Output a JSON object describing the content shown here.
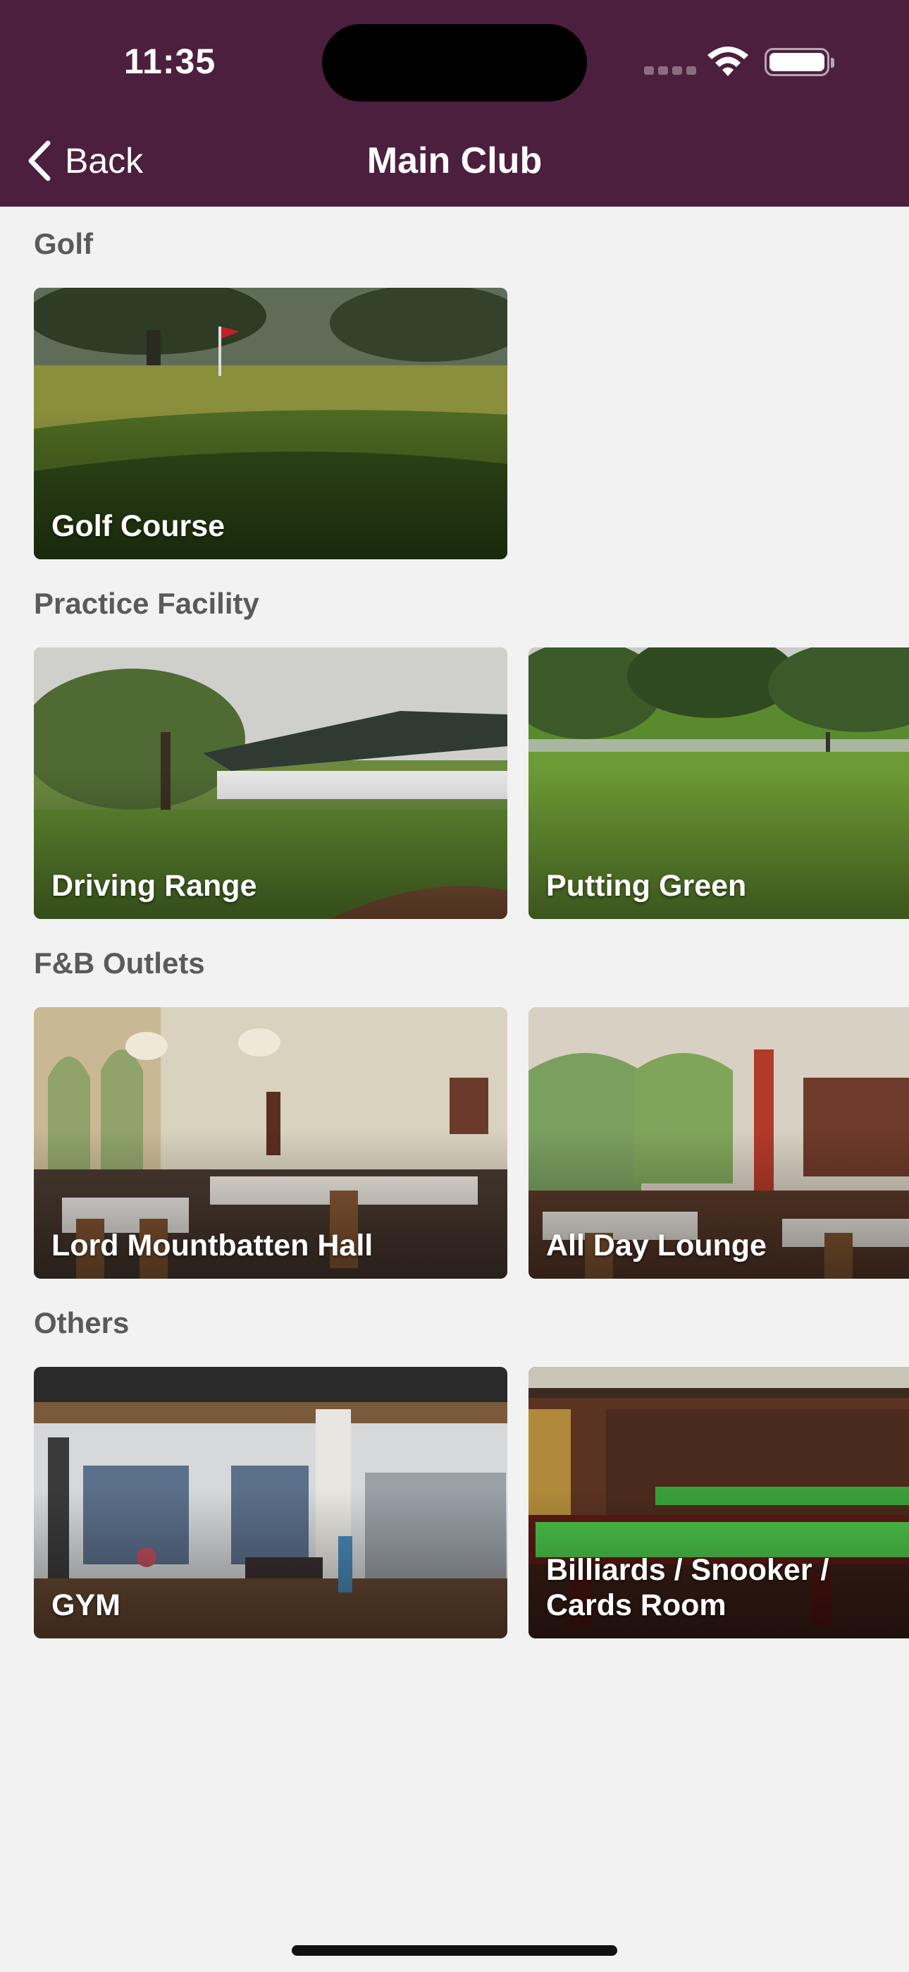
{
  "status_bar": {
    "time": "11:35"
  },
  "nav": {
    "back_label": "Back",
    "title": "Main Club"
  },
  "sections": [
    {
      "label": "Golf",
      "items": [
        "Golf Course"
      ]
    },
    {
      "label": "Practice Facility",
      "items": [
        "Driving Range",
        "Putting Green"
      ]
    },
    {
      "label": "F&B Outlets",
      "items": [
        "Lord Mountbatten Hall",
        "All Day Lounge"
      ]
    },
    {
      "label": "Others",
      "items": [
        "GYM",
        "Billiards / Snooker / Cards Room"
      ]
    }
  ],
  "colors": {
    "header": "#4d1f3f",
    "background": "#f2f2f2"
  },
  "icons": [
    "chevron-left-icon",
    "wifi-icon",
    "battery-icon",
    "signal-icon"
  ]
}
